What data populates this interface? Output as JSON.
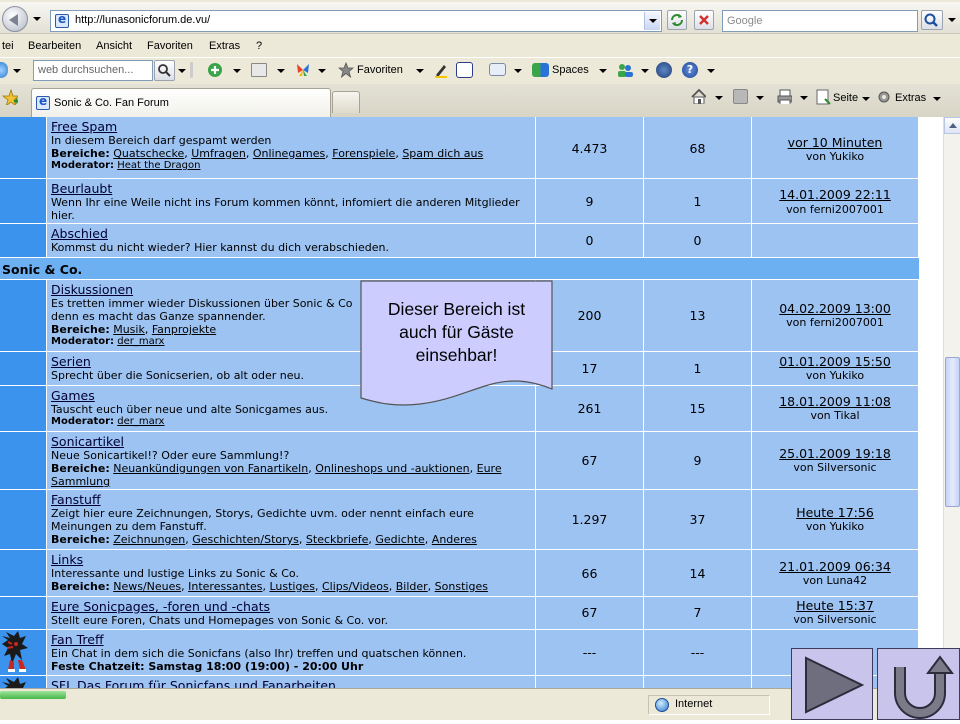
{
  "browser": {
    "url": "http://lunasonicforum.de.vu/",
    "search_placeholder": "Google",
    "menu": [
      "tei",
      "Bearbeiten",
      "Ansicht",
      "Favoriten",
      "Extras",
      "?"
    ],
    "toolbar": {
      "web_search_placeholder": "web durchsuchen...",
      "favorites_label": "Favoriten",
      "spaces_label": "Spaces"
    },
    "tab_title": "Sonic & Co. Fan Forum",
    "command_bar": {
      "page_label": "Seite",
      "extras_label": "Extras"
    },
    "status_zone": "Internet",
    "icons": [
      "back-icon",
      "page-icon",
      "refresh-icon",
      "stop-icon",
      "search-icon",
      "add-tab-icon",
      "home-icon",
      "feeds-icon",
      "print-icon",
      "page-icon",
      "tools-icon",
      "globe-icon"
    ]
  },
  "forum": {
    "rows_top": [
      {
        "name": "Free Spam",
        "description": "In diesem Bereich darf gespamt werden",
        "subforums_label": "Bereiche:",
        "subforums": [
          "Quatschecke",
          "Umfragen",
          "Onlinegames",
          "Forenspiele",
          "Spam dich aus"
        ],
        "moderator_label": "Moderator:",
        "moderator": "Heat the Dragon",
        "topics": "4.473",
        "posts": "68",
        "last_date": "vor 10 Minuten",
        "last_by": "von Yukiko"
      },
      {
        "name": "Beurlaubt",
        "description": "Wenn Ihr eine Weile nicht ins Forum kommen könnt, infomiert die anderen Mitglieder hier.",
        "topics": "9",
        "posts": "1",
        "last_date": "14.01.2009 22:11",
        "last_by": "von ferni2007001"
      },
      {
        "name": "Abschied",
        "description": "Kommst du nicht wieder? Hier kannst du dich verabschieden.",
        "topics": "0",
        "posts": "0",
        "last_date": "",
        "last_by": ""
      }
    ],
    "category": "Sonic & Co.",
    "rows_sonic": [
      {
        "name": "Diskussionen",
        "description": "Es tretten immer wieder Diskussionen über Sonic & Co",
        "description2": "denn es macht das Ganze spannender.",
        "subforums_label": "Bereiche:",
        "subforums": [
          "Musik",
          "Fanprojekte"
        ],
        "moderator_label": "Moderator:",
        "moderator": "der_marx",
        "topics": "200",
        "posts": "13",
        "last_date": "04.02.2009 13:00",
        "last_by": "von ferni2007001"
      },
      {
        "name": "Serien",
        "description": "Sprecht über die Sonicserien, ob alt oder neu.",
        "topics": "17",
        "posts": "1",
        "last_date": "01.01.2009 15:50",
        "last_by": "von Yukiko"
      },
      {
        "name": "Games",
        "description": "Tauscht euch über neue und alte Sonicgames aus.",
        "moderator_label": "Moderator:",
        "moderator": "der_marx",
        "topics": "261",
        "posts": "15",
        "last_date": "18.01.2009 11:08",
        "last_by": "von Tikal"
      },
      {
        "name": "Sonicartikel",
        "description": "Neue Sonicartikel!? Oder eure Sammlung!?",
        "subforums_label": "Bereiche:",
        "subforums": [
          "Neuankündigungen von Fanartikeln",
          "Onlineshops und -auktionen",
          "Eure Sammlung"
        ],
        "topics": "67",
        "posts": "9",
        "last_date": "25.01.2009 19:18",
        "last_by": "von Silversonic"
      },
      {
        "name": "Fanstuff",
        "description": "Zeigt hier eure Zeichnungen, Storys, Gedichte uvm. oder nennt einfach eure Meinungen zu dem Fanstuff.",
        "subforums_label": "Bereiche:",
        "subforums": [
          "Zeichnungen",
          "Geschichten/Storys",
          "Steckbriefe",
          "Gedichte",
          "Anderes"
        ],
        "topics": "1.297",
        "posts": "37",
        "last_date": "Heute 17:56",
        "last_by": "von Yukiko"
      },
      {
        "name": "Links",
        "description": "Interessante und lustige Links zu Sonic & Co.",
        "subforums_label": "Bereiche:",
        "subforums": [
          "News/Neues",
          "Interessantes",
          "Lustiges",
          "Clips/Videos",
          "Bilder",
          "Sonstiges"
        ],
        "topics": "66",
        "posts": "14",
        "last_date": "21.01.2009 06:34",
        "last_by": "von Luna42"
      },
      {
        "name": "Eure Sonicpages, -foren und -chats",
        "description": "Stellt eure Foren, Chats und Homepages von Sonic & Co. vor.",
        "topics": "67",
        "posts": "7",
        "last_date": "Heute 15:37",
        "last_by": "von Silversonic"
      },
      {
        "name": "Fan Treff",
        "description": "Ein Chat in dem sich die Sonicfans (also Ihr) treffen und quatschen können.",
        "chat_time": "Feste Chatzeit: Samstag 18:00 (19:00) - 20:00 Uhr",
        "topics": "---",
        "posts": "---",
        "last_date": "",
        "last_by": ""
      },
      {
        "name": "SFL Das Forum für Sonicfans und Fanarbeiten",
        "topics": "",
        "posts": ""
      }
    ]
  },
  "callout": {
    "text_line1": "Dieser Bereich ist",
    "text_line2": "auch für Gäste",
    "text_line3": "einsehbar!"
  },
  "nav_buttons": [
    "play-next-button",
    "return-button"
  ]
}
